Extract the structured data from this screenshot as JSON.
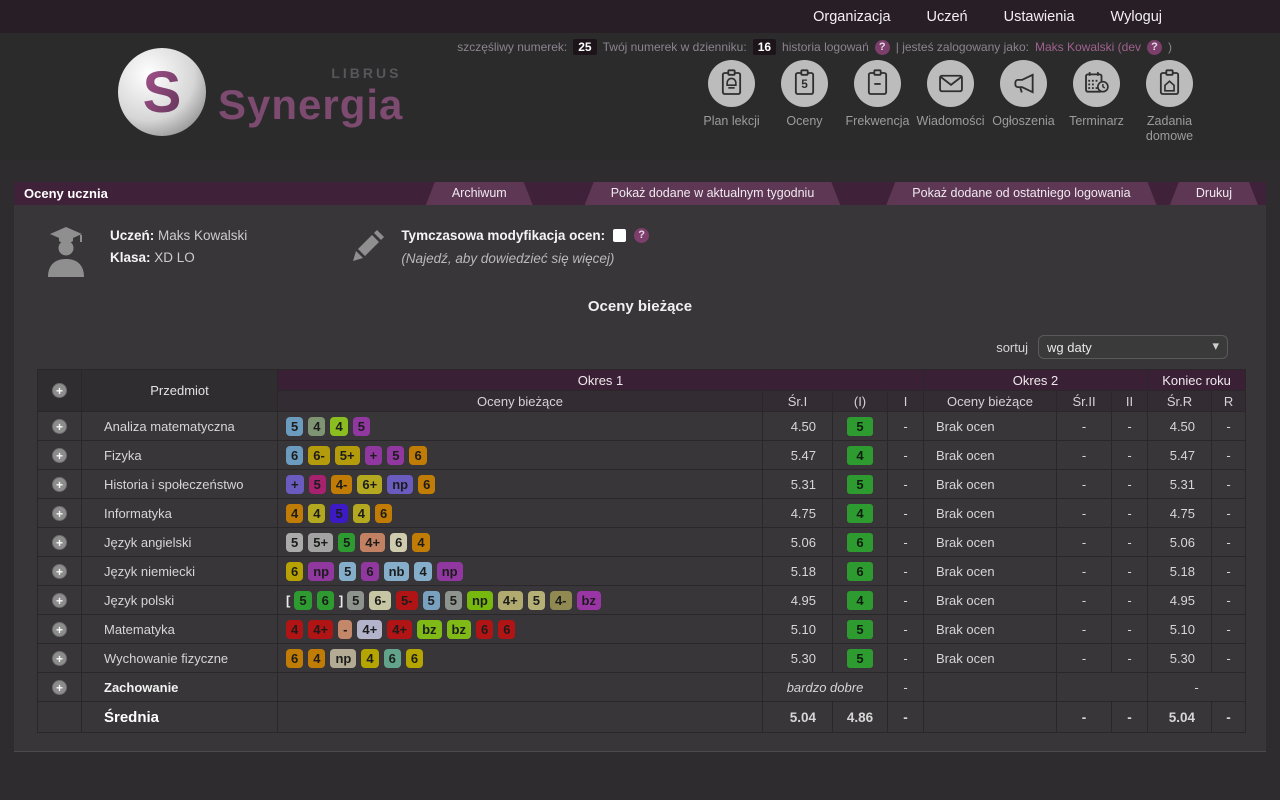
{
  "topbar": {
    "menu": [
      {
        "id": "organizacja",
        "label": "Organizacja"
      },
      {
        "id": "uczen",
        "label": "Uczeń"
      },
      {
        "id": "ustawienia",
        "label": "Ustawienia"
      },
      {
        "id": "wyloguj",
        "label": "Wyloguj"
      }
    ]
  },
  "infobar": {
    "lucky_label": "szczęśliwy numerek:",
    "lucky_value": "25",
    "journal_label": "Twój numerek w dzienniku:",
    "journal_value": "16",
    "history_label": "historia logowań",
    "logged_label": "| jesteś zalogowany jako:",
    "logged_user": "Maks Kowalski (dev",
    "logged_suffix": ")"
  },
  "logo": {
    "brand": "Synergia",
    "sub": "LIBRUS"
  },
  "nav": {
    "items": [
      {
        "id": "plan-lekcji",
        "label": "Plan lekcji",
        "icon": "clipboard-bell-icon"
      },
      {
        "id": "oceny",
        "label": "Oceny",
        "icon": "clipboard-5-icon"
      },
      {
        "id": "frekwencja",
        "label": "Frekwencja",
        "icon": "clipboard-minus-icon"
      },
      {
        "id": "wiadomosci",
        "label": "Wiadomości",
        "icon": "envelope-icon"
      },
      {
        "id": "ogloszenia",
        "label": "Ogłoszenia",
        "icon": "megaphone-icon"
      },
      {
        "id": "terminarz",
        "label": "Terminarz",
        "icon": "calendar-clock-icon"
      },
      {
        "id": "zadania-domowe",
        "label": "Zadania domowe",
        "icon": "clipboard-house-icon"
      }
    ]
  },
  "tabbar": {
    "title": "Oceny ucznia",
    "buttons": [
      {
        "id": "archiwum",
        "label": "Archiwum"
      },
      {
        "id": "pokaz-tydzien",
        "label": "Pokaż dodane w aktualnym tygodniu"
      },
      {
        "id": "pokaz-logowanie",
        "label": "Pokaż dodane od ostatniego logowania"
      },
      {
        "id": "drukuj",
        "label": "Drukuj"
      }
    ]
  },
  "student": {
    "uczen_label": "Uczeń:",
    "uczen": "Maks Kowalski",
    "klasa_label": "Klasa:",
    "klasa": "XD LO"
  },
  "modify": {
    "label": "Tymczasowa modyfikacja ocen:",
    "hint": "(Najedź, aby dowiedzieć się więcej)"
  },
  "section_title": "Oceny bieżące",
  "sort": {
    "label": "sortuj",
    "value": "wg daty"
  },
  "colors": {
    "badge_green": "#2E9B31",
    "brand_purple": "#7d4a70"
  },
  "table": {
    "headers": {
      "przedmiot": "Przedmiot",
      "okres1": "Okres 1",
      "okres2": "Okres 2",
      "koniec": "Koniec roku",
      "oceny1": "Oceny bieżące",
      "sr1": "Śr.I",
      "i_paren": "(I)",
      "i": "I",
      "oceny2": "Oceny bieżące",
      "sr2": "Śr.II",
      "ii": "II",
      "srr": "Śr.R",
      "r": "R"
    },
    "rows": [
      {
        "type": "subject",
        "expand": true,
        "name": "Analiza matematyczna",
        "grades": [
          {
            "t": "5",
            "c": "#6B9BBE"
          },
          {
            "t": "4",
            "c": "#7E9472"
          },
          {
            "t": "4",
            "c": "#8ABD1F"
          },
          {
            "t": "5",
            "c": "#9138A0"
          }
        ],
        "sr1": "4.50",
        "i_badge": "5",
        "i1": "-",
        "okres2": "Brak ocen",
        "sr2": "-",
        "ii": "-",
        "srr": "4.50",
        "r": "-"
      },
      {
        "type": "subject",
        "expand": true,
        "name": "Fizyka",
        "grades": [
          {
            "t": "6",
            "c": "#6B9BBE"
          },
          {
            "t": "6-",
            "c": "#B49B0C"
          },
          {
            "t": "5+",
            "c": "#B49B0C"
          },
          {
            "t": "+",
            "c": "#9138A0"
          },
          {
            "t": "5",
            "c": "#9138A0"
          },
          {
            "t": "6",
            "c": "#C17C06"
          }
        ],
        "sr1": "5.47",
        "i_badge": "4",
        "i1": "-",
        "okres2": "Brak ocen",
        "sr2": "-",
        "ii": "-",
        "srr": "5.47",
        "r": "-"
      },
      {
        "type": "subject",
        "expand": true,
        "name": "Historia i społeczeństwo",
        "grades": [
          {
            "t": "+",
            "c": "#6A5BBF"
          },
          {
            "t": "5",
            "c": "#A6216E"
          },
          {
            "t": "4-",
            "c": "#C17C06"
          },
          {
            "t": "6+",
            "c": "#B3A81F"
          },
          {
            "t": "np",
            "c": "#6A5BBF"
          },
          {
            "t": "6",
            "c": "#C17C06"
          }
        ],
        "sr1": "5.31",
        "i_badge": "5",
        "i1": "-",
        "okres2": "Brak ocen",
        "sr2": "-",
        "ii": "-",
        "srr": "5.31",
        "r": "-"
      },
      {
        "type": "subject",
        "expand": true,
        "name": "Informatyka",
        "grades": [
          {
            "t": "4",
            "c": "#C17C06"
          },
          {
            "t": "4",
            "c": "#B3A81F"
          },
          {
            "t": "5",
            "c": "#3D1BC4"
          },
          {
            "t": "4",
            "c": "#B3A81F"
          },
          {
            "t": "6",
            "c": "#C17C06"
          }
        ],
        "sr1": "4.75",
        "i_badge": "4",
        "i1": "-",
        "okres2": "Brak ocen",
        "sr2": "-",
        "ii": "-",
        "srr": "4.75",
        "r": "-"
      },
      {
        "type": "subject",
        "expand": true,
        "name": "Język angielski",
        "grades": [
          {
            "t": "5",
            "c": "#ABABAB"
          },
          {
            "t": "5+",
            "c": "#A3A3A3"
          },
          {
            "t": "5",
            "c": "#2E9B31"
          },
          {
            "t": "4+",
            "c": "#C28163"
          },
          {
            "t": "6",
            "c": "#CECBAE"
          },
          {
            "t": "4",
            "c": "#C17C06"
          }
        ],
        "sr1": "5.06",
        "i_badge": "6",
        "i1": "-",
        "okres2": "Brak ocen",
        "sr2": "-",
        "ii": "-",
        "srr": "5.06",
        "r": "-"
      },
      {
        "type": "subject",
        "expand": true,
        "name": "Język niemiecki",
        "grades": [
          {
            "t": "6",
            "c": "#B8A203"
          },
          {
            "t": "np",
            "c": "#9138A0"
          },
          {
            "t": "5",
            "c": "#85AECB"
          },
          {
            "t": "6",
            "c": "#9138A0"
          },
          {
            "t": "nb",
            "c": "#85AECB"
          },
          {
            "t": "4",
            "c": "#85AECB"
          },
          {
            "t": "np",
            "c": "#9138A0"
          }
        ],
        "sr1": "5.18",
        "i_badge": "6",
        "i1": "-",
        "okres2": "Brak ocen",
        "sr2": "-",
        "ii": "-",
        "srr": "5.18",
        "r": "-"
      },
      {
        "type": "subject",
        "expand": true,
        "name": "Język polski",
        "grades": [
          {
            "b": "["
          },
          {
            "t": "5",
            "c": "#2E9B31"
          },
          {
            "t": "6",
            "c": "#2E9B31"
          },
          {
            "b": "]"
          },
          {
            "t": "5",
            "c": "#8D938D"
          },
          {
            "t": "6-",
            "c": "#C6C6A4"
          },
          {
            "t": "5-",
            "c": "#B11414"
          },
          {
            "t": "5",
            "c": "#7AA0BF"
          },
          {
            "t": "5",
            "c": "#8D938D"
          },
          {
            "t": "np",
            "c": "#76B80E"
          },
          {
            "t": "4+",
            "c": "#B1AA6E"
          },
          {
            "t": "5",
            "c": "#B5B075"
          },
          {
            "t": "4-",
            "c": "#908A52"
          },
          {
            "t": "bz",
            "c": "#9A35A5"
          }
        ],
        "sr1": "4.95",
        "i_badge": "4",
        "i1": "-",
        "okres2": "Brak ocen",
        "sr2": "-",
        "ii": "-",
        "srr": "4.95",
        "r": "-"
      },
      {
        "type": "subject",
        "expand": true,
        "name": "Matematyka",
        "grades": [
          {
            "t": "4",
            "c": "#B11414"
          },
          {
            "t": "4+",
            "c": "#B11414"
          },
          {
            "t": "-",
            "c": "#C28869"
          },
          {
            "t": "4+",
            "c": "#B3B3CC"
          },
          {
            "t": "4+",
            "c": "#B11414"
          },
          {
            "t": "bz",
            "c": "#7FBA17"
          },
          {
            "t": "bz",
            "c": "#7FBA17"
          },
          {
            "t": "6",
            "c": "#B11414"
          },
          {
            "t": "6",
            "c": "#B11414"
          }
        ],
        "sr1": "5.10",
        "i_badge": "5",
        "i1": "-",
        "okres2": "Brak ocen",
        "sr2": "-",
        "ii": "-",
        "srr": "5.10",
        "r": "-"
      },
      {
        "type": "subject",
        "expand": true,
        "name": "Wychowanie fizyczne",
        "grades": [
          {
            "t": "6",
            "c": "#C17C06"
          },
          {
            "t": "4",
            "c": "#C17C06"
          },
          {
            "t": "np",
            "c": "#B3AB93"
          },
          {
            "t": "4",
            "c": "#B5A500"
          },
          {
            "t": "6",
            "c": "#62A38C"
          },
          {
            "t": "6",
            "c": "#B5A500"
          }
        ],
        "sr1": "5.30",
        "i_badge": "5",
        "i1": "-",
        "okres2": "Brak ocen",
        "sr2": "-",
        "ii": "-",
        "srr": "5.30",
        "r": "-"
      },
      {
        "type": "behavior",
        "expand": true,
        "name": "Zachowanie",
        "sr_text": "bardzo dobre",
        "i1": "-",
        "srr": "-"
      },
      {
        "type": "summary",
        "expand": false,
        "name": "Średnia",
        "sr1": "5.04",
        "i_val": "4.86",
        "i1": "-",
        "sr2": "-",
        "ii": "-",
        "srr": "5.04",
        "r": "-"
      }
    ]
  }
}
